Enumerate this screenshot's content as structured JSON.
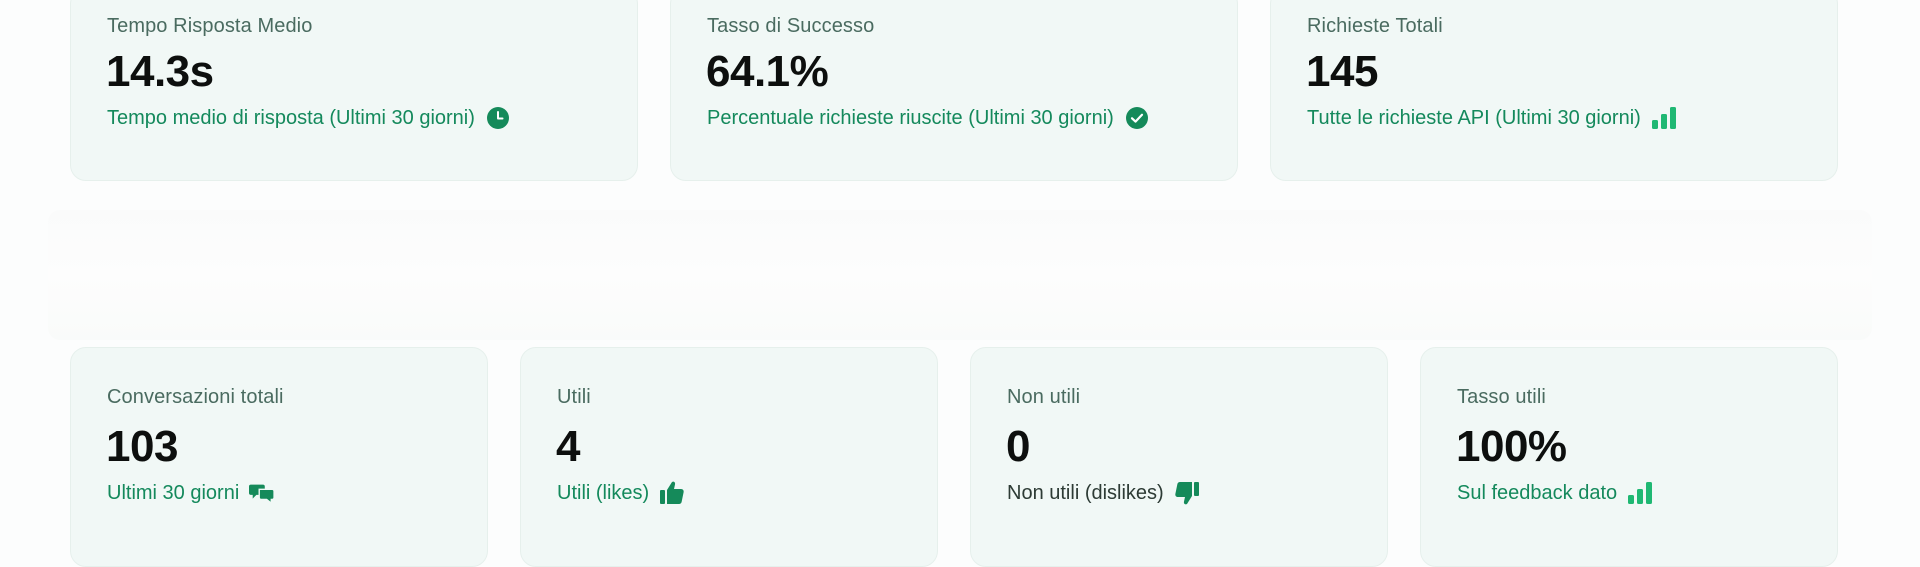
{
  "colors": {
    "card_bg": "#f1f8f6",
    "accent_green": "#14895c",
    "icon_green_light": "#1fb873",
    "icon_green_dark": "#158a5a",
    "label_gray": "#4a6b60",
    "value_black": "#0d0f0e"
  },
  "top_stats": [
    {
      "label": "Tempo Risposta Medio",
      "value": "14.3s",
      "caption": "Tempo medio di risposta (Ultimi 30 giorni)",
      "icon": "clock-icon"
    },
    {
      "label": "Tasso di Successo",
      "value": "64.1%",
      "caption": "Percentuale richieste riuscite (Ultimi 30 giorni)",
      "icon": "check-circle-icon"
    },
    {
      "label": "Richieste Totali",
      "value": "145",
      "caption": "Tutte le richieste API (Ultimi 30 giorni)",
      "icon": "bar-chart-icon"
    }
  ],
  "feedback_stats": [
    {
      "label": "Conversazioni totali",
      "value": "103",
      "caption": "Ultimi 30 giorni",
      "icon": "chat-bubbles-icon"
    },
    {
      "label": "Utili",
      "value": "4",
      "caption": "Utili (likes)",
      "icon": "thumbs-up-icon"
    },
    {
      "label": "Non utili",
      "value": "0",
      "caption": "Non utili (dislikes)",
      "icon": "thumbs-down-icon"
    },
    {
      "label": "Tasso utili",
      "value": "100%",
      "caption": "Sul feedback dato",
      "icon": "bar-chart-icon"
    }
  ]
}
